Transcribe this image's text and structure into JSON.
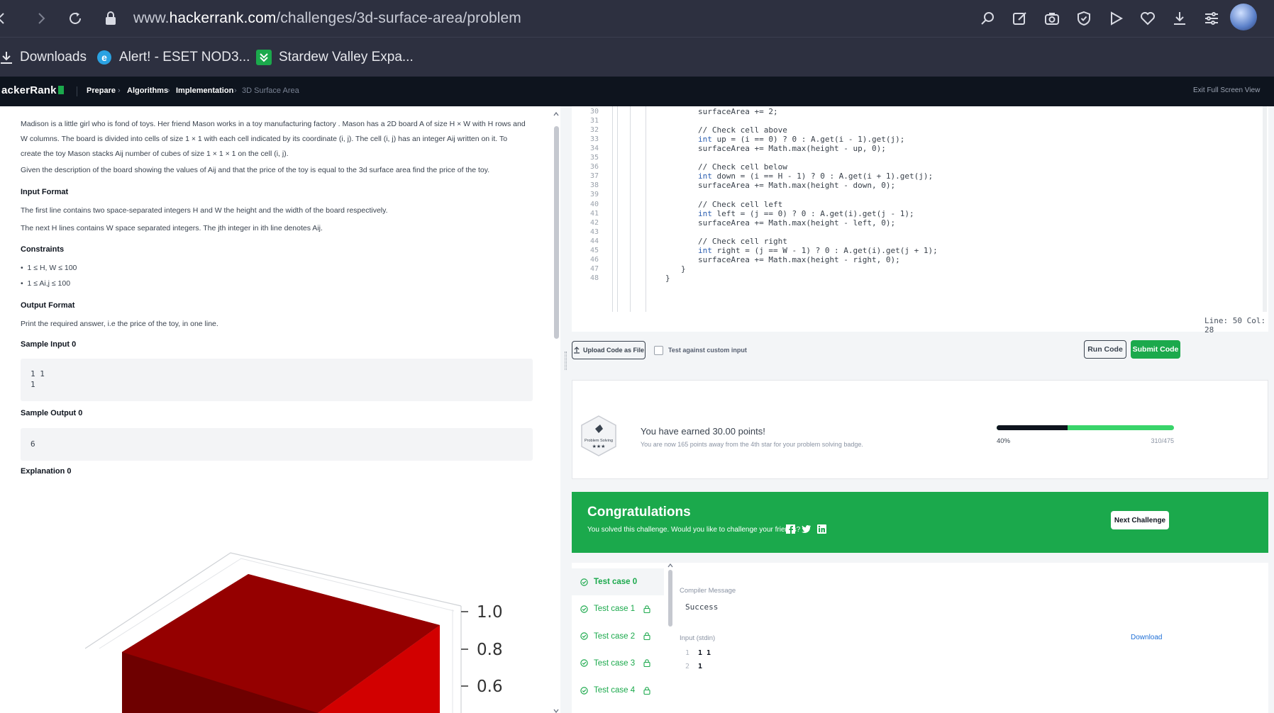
{
  "browser": {
    "url_prefix": "www.",
    "url_domain": "hackerrank.com",
    "url_path": "/challenges/3d-surface-area/problem"
  },
  "bookmarks": [
    {
      "label": "Downloads",
      "icon": "download-icon"
    },
    {
      "label": "Alert! - ESET NOD3...",
      "icon": "edge-icon"
    },
    {
      "label": "Stardew Valley Expa...",
      "icon": "stardew-icon"
    }
  ],
  "hr_header": {
    "logo": "ackerRank",
    "crumbs": [
      "Prepare",
      "Algorithms",
      "Implementation",
      "3D Surface Area"
    ],
    "exit_fullscreen": "Exit Full Screen View"
  },
  "problem": {
    "para1_line1": "Madison is a little girl who is fond of toys. Her friend Mason works in a toy manufacturing factory . Mason has a 2D board A of size H × W with H rows and",
    "para1_line2": "W columns. The board is divided into cells of size 1 × 1 with each cell indicated by its coordinate (i, j). The cell (i, j) has an integer Aij written on it. To",
    "para1_line3": "create the toy Mason stacks Aij number of cubes of size 1 × 1 × 1 on the cell (i, j).",
    "para2": "Given the description of the board showing the values of Aij and that the price of the toy is equal to the 3d surface area find the price of the toy.",
    "input_format_heading": "Input Format",
    "input_line1": "The first line contains two space-separated integers H and W the height and the width of the board respectively.",
    "input_line2": "The next H lines contains W space separated integers. The jth integer in ith line denotes Aij.",
    "constraints_heading": "Constraints",
    "constraint1": "1 ≤ H, W ≤ 100",
    "constraint2": "1 ≤ Ai,j ≤ 100",
    "output_format_heading": "Output Format",
    "output_line": "Print the required answer, i.e the price of the toy, in one line.",
    "sample_input_heading": "Sample Input 0",
    "sample_input_l1": "1 1",
    "sample_input_l2": "1",
    "sample_output_heading": "Sample Output 0",
    "sample_output": "6",
    "explanation_heading": "Explanation 0",
    "axis_labels": [
      "1.0",
      "0.8",
      "0.6"
    ]
  },
  "editor": {
    "line_numbers": [
      "30",
      "31",
      "32",
      "33",
      "34",
      "35",
      "36",
      "37",
      "38",
      "39",
      "40",
      "41",
      "42",
      "43",
      "44",
      "45",
      "46",
      "47",
      "48"
    ],
    "lines": [
      {
        "indent": 3,
        "text": "surfaceArea += 2;"
      },
      {
        "indent": 0,
        "text": ""
      },
      {
        "indent": 3,
        "text": "// Check cell above",
        "type": "comment"
      },
      {
        "indent": 3,
        "text": "int up = (i == 0) ? 0 : A.get(i - 1).get(j);",
        "type": "int"
      },
      {
        "indent": 3,
        "text": "surfaceArea += Math.max(height - up, 0);"
      },
      {
        "indent": 0,
        "text": ""
      },
      {
        "indent": 3,
        "text": "// Check cell below",
        "type": "comment"
      },
      {
        "indent": 3,
        "text": "int down = (i == H - 1) ? 0 : A.get(i + 1).get(j);",
        "type": "int"
      },
      {
        "indent": 3,
        "text": "surfaceArea += Math.max(height - down, 0);"
      },
      {
        "indent": 0,
        "text": ""
      },
      {
        "indent": 3,
        "text": "// Check cell left",
        "type": "comment"
      },
      {
        "indent": 3,
        "text": "int left = (j == 0) ? 0 : A.get(i).get(j - 1);",
        "type": "int"
      },
      {
        "indent": 3,
        "text": "surfaceArea += Math.max(height - left, 0);"
      },
      {
        "indent": 0,
        "text": ""
      },
      {
        "indent": 3,
        "text": "// Check cell right",
        "type": "comment"
      },
      {
        "indent": 3,
        "text": "int right = (j == W - 1) ? 0 : A.get(i).get(j + 1);",
        "type": "int"
      },
      {
        "indent": 3,
        "text": "surfaceArea += Math.max(height - right, 0);"
      },
      {
        "indent": 2,
        "text": "}"
      },
      {
        "indent": 1,
        "text": "}"
      }
    ],
    "line_col": "Line: 50 Col: 28"
  },
  "actions": {
    "upload_label": "Upload Code as File",
    "custom_input_label": "Test against custom input",
    "run_label": "Run Code",
    "submit_label": "Submit Code"
  },
  "result": {
    "badge_label": "Problem Solving",
    "earned": "You have earned 30.00 points!",
    "subtext": "You are now 165 points away from the 4th star for your problem solving badge.",
    "progress_label": "40%",
    "progress_fraction": 0.4,
    "progress_count": "310/475"
  },
  "congrats": {
    "title": "Congratulations",
    "subtitle": "You solved this challenge. Would you like to challenge your friends?",
    "next_label": "Next Challenge"
  },
  "tests": {
    "cases": [
      {
        "label": "Test case 0",
        "locked": false
      },
      {
        "label": "Test case 1",
        "locked": true
      },
      {
        "label": "Test case 2",
        "locked": true
      },
      {
        "label": "Test case 3",
        "locked": true
      },
      {
        "label": "Test case 4",
        "locked": true
      }
    ],
    "compiler_label": "Compiler Message",
    "compiler_value": "Success",
    "input_label": "Input (stdin)",
    "download_label": "Download",
    "input_rows": [
      {
        "num": "1",
        "val": "1 1"
      },
      {
        "num": "2",
        "val": "1"
      }
    ]
  },
  "colors": {
    "accent_green": "#1ba94c",
    "header_dark": "#0e141e",
    "browser_dark": "#2d3040",
    "cube_red": "#c40000"
  }
}
